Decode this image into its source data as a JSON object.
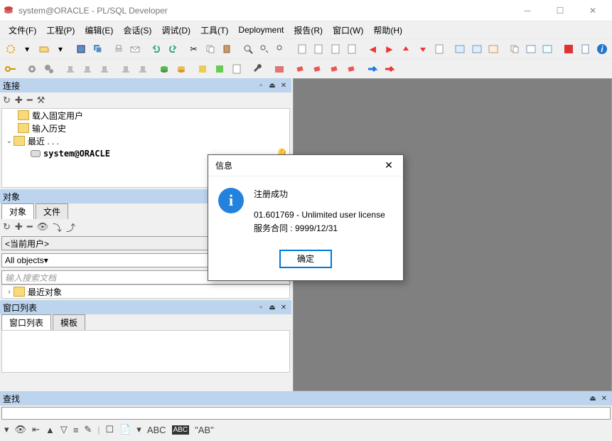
{
  "title": "system@ORACLE - PL/SQL Developer",
  "menu": {
    "file": "文件(F)",
    "project": "工程(P)",
    "edit": "编辑(E)",
    "session": "会话(S)",
    "debug": "调试(D)",
    "tools": "工具(T)",
    "deployment": "Deployment",
    "report": "报告(R)",
    "window": "窗口(W)",
    "help": "帮助(H)"
  },
  "panels": {
    "connections": {
      "title": "连接"
    },
    "objects": {
      "title": "对象",
      "tab_objects": "对象",
      "tab_files": "文件",
      "current_user": "<当前用户>",
      "all_objects": "All objects",
      "search_placeholder": "输入搜索文档",
      "recent_objects": "最近对象"
    },
    "windowlist": {
      "title": "窗口列表",
      "tab_list": "窗口列表",
      "tab_template": "模板"
    },
    "search": {
      "title": "查找"
    }
  },
  "tree": {
    "load_fixed_users": "载入固定用户",
    "input_history": "输入历史",
    "recent": "最近 . . .",
    "connection_name": "system@ORACLE"
  },
  "search_toolbar": {
    "abc": "ABC",
    "abc_alt": "ABC",
    "ab_quoted": "\"AB\""
  },
  "dialog": {
    "title": "信息",
    "success": "注册成功",
    "license_line": "01.601769 - Unlimited user license",
    "contract_line": "服务合同 : 9999/12/31",
    "ok_button": "确定"
  }
}
